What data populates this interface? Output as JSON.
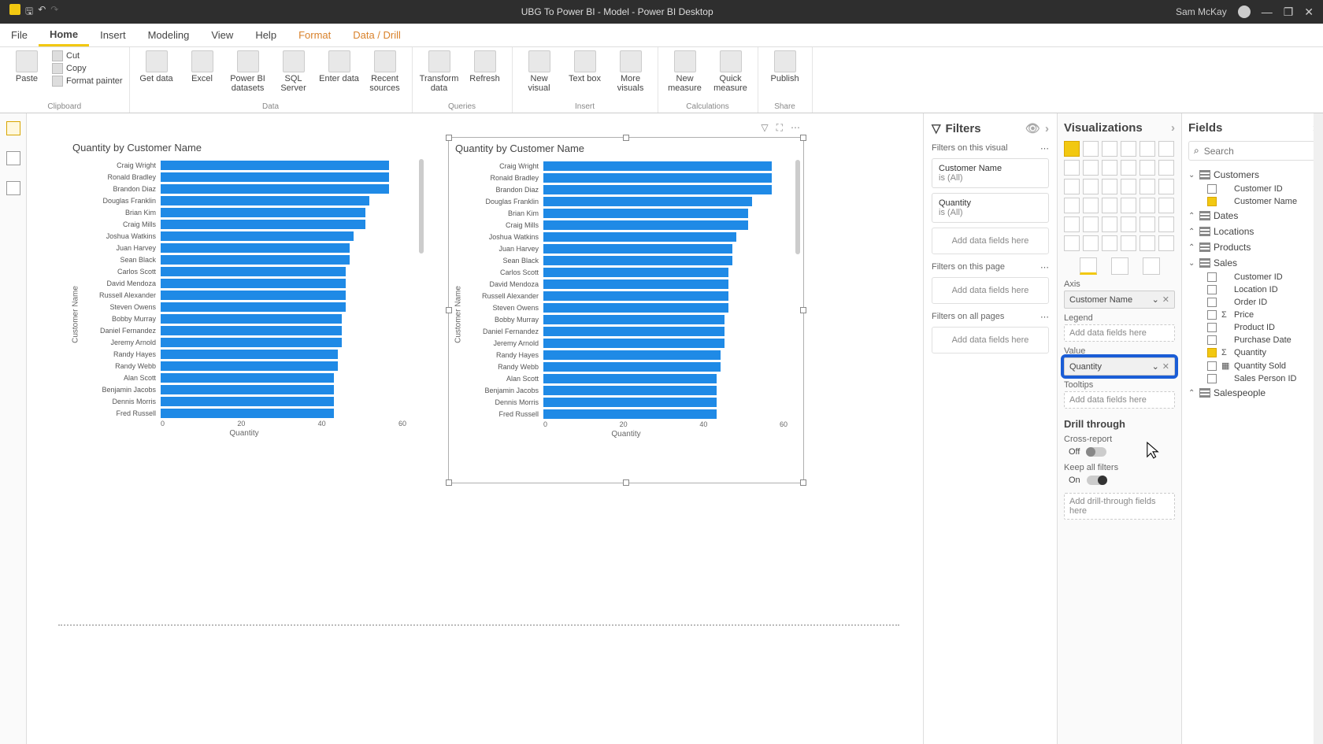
{
  "app": {
    "title": "UBG To Power BI - Model - Power BI Desktop",
    "user": "Sam McKay"
  },
  "menu": {
    "items": [
      "File",
      "Home",
      "Insert",
      "Modeling",
      "View",
      "Help",
      "Format",
      "Data / Drill"
    ],
    "active": "Home"
  },
  "ribbon": {
    "clipboard": {
      "label": "Clipboard",
      "paste": "Paste",
      "cut": "Cut",
      "copy": "Copy",
      "painter": "Format painter"
    },
    "data": {
      "label": "Data",
      "get": "Get data",
      "excel": "Excel",
      "pbids": "Power BI datasets",
      "sql": "SQL Server",
      "enter": "Enter data",
      "recent": "Recent sources"
    },
    "queries": {
      "label": "Queries",
      "transform": "Transform data",
      "refresh": "Refresh"
    },
    "insert": {
      "label": "Insert",
      "newvis": "New visual",
      "text": "Text box",
      "more": "More visuals"
    },
    "calc": {
      "label": "Calculations",
      "newmeas": "New measure",
      "quick": "Quick measure"
    },
    "share": {
      "label": "Share",
      "publish": "Publish"
    }
  },
  "filters_pane": {
    "title": "Filters",
    "on_visual": "Filters on this visual",
    "on_page": "Filters on this page",
    "on_all": "Filters on all pages",
    "add": "Add data fields here",
    "cards": [
      {
        "name": "Customer Name",
        "val": "is (All)"
      },
      {
        "name": "Quantity",
        "val": "is (All)"
      }
    ]
  },
  "viz_pane": {
    "title": "Visualizations",
    "axis": "Axis",
    "axis_field": "Customer Name",
    "legend": "Legend",
    "value": "Value",
    "value_field": "Quantity",
    "tooltips": "Tooltips",
    "add": "Add data fields here",
    "drill": "Drill through",
    "cross": "Cross-report",
    "off": "Off",
    "keep": "Keep all filters",
    "on": "On",
    "adddrill": "Add drill-through fields here"
  },
  "fields_pane": {
    "title": "Fields",
    "search_ph": "Search",
    "tables": [
      {
        "name": "Customers",
        "expanded": true,
        "fields": [
          {
            "name": "Customer ID",
            "checked": false
          },
          {
            "name": "Customer Name",
            "checked": true
          }
        ]
      },
      {
        "name": "Dates",
        "expanded": false
      },
      {
        "name": "Locations",
        "expanded": false
      },
      {
        "name": "Products",
        "expanded": false
      },
      {
        "name": "Sales",
        "expanded": true,
        "fields": [
          {
            "name": "Customer ID",
            "checked": false
          },
          {
            "name": "Location ID",
            "checked": false
          },
          {
            "name": "Order ID",
            "checked": false
          },
          {
            "name": "Price",
            "checked": false,
            "sigma": true
          },
          {
            "name": "Product ID",
            "checked": false
          },
          {
            "name": "Purchase Date",
            "checked": false
          },
          {
            "name": "Quantity",
            "checked": true,
            "sigma": true
          },
          {
            "name": "Quantity Sold",
            "checked": false,
            "calc": true
          },
          {
            "name": "Sales Person ID",
            "checked": false
          }
        ]
      },
      {
        "name": "Salespeople",
        "expanded": false
      }
    ]
  },
  "chart_data": [
    {
      "type": "bar",
      "title": "Quantity by Customer Name",
      "xlabel": "Quantity",
      "ylabel": "Customer Name",
      "xlim": [
        0,
        60
      ],
      "xticks": [
        0,
        20,
        40,
        60
      ],
      "categories": [
        "Craig Wright",
        "Ronald Bradley",
        "Brandon Diaz",
        "Douglas Franklin",
        "Brian Kim",
        "Craig Mills",
        "Joshua Watkins",
        "Juan Harvey",
        "Sean Black",
        "Carlos Scott",
        "David Mendoza",
        "Russell Alexander",
        "Steven Owens",
        "Bobby Murray",
        "Daniel Fernandez",
        "Jeremy Arnold",
        "Randy Hayes",
        "Randy Webb",
        "Alan Scott",
        "Benjamin Jacobs",
        "Dennis Morris",
        "Fred Russell"
      ],
      "values": [
        58,
        58,
        58,
        53,
        52,
        52,
        49,
        48,
        48,
        47,
        47,
        47,
        47,
        46,
        46,
        46,
        45,
        45,
        44,
        44,
        44,
        44
      ]
    },
    {
      "type": "bar",
      "title": "Quantity by Customer Name",
      "xlabel": "Quantity",
      "ylabel": "Customer Name",
      "xlim": [
        0,
        60
      ],
      "xticks": [
        0,
        20,
        40,
        60
      ],
      "categories": [
        "Craig Wright",
        "Ronald Bradley",
        "Brandon Diaz",
        "Douglas Franklin",
        "Brian Kim",
        "Craig Mills",
        "Joshua Watkins",
        "Juan Harvey",
        "Sean Black",
        "Carlos Scott",
        "David Mendoza",
        "Russell Alexander",
        "Steven Owens",
        "Bobby Murray",
        "Daniel Fernandez",
        "Jeremy Arnold",
        "Randy Hayes",
        "Randy Webb",
        "Alan Scott",
        "Benjamin Jacobs",
        "Dennis Morris",
        "Fred Russell"
      ],
      "values": [
        58,
        58,
        58,
        53,
        52,
        52,
        49,
        48,
        48,
        47,
        47,
        47,
        47,
        46,
        46,
        46,
        45,
        45,
        44,
        44,
        44,
        44
      ]
    }
  ]
}
